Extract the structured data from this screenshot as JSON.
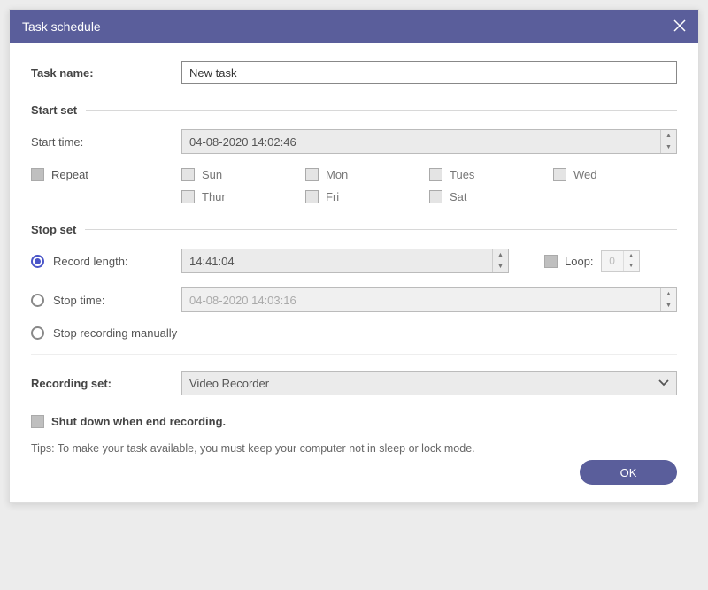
{
  "title": "Task schedule",
  "task_name_label": "Task name:",
  "task_name_value": "New task",
  "start_set": {
    "heading": "Start set",
    "start_time_label": "Start time:",
    "start_time_value": "04-08-2020 14:02:46",
    "repeat_label": "Repeat",
    "days": [
      "Sun",
      "Mon",
      "Tues",
      "Wed",
      "Thur",
      "Fri",
      "Sat"
    ]
  },
  "stop_set": {
    "heading": "Stop set",
    "record_length_label": "Record length:",
    "record_length_value": "14:41:04",
    "loop_label": "Loop:",
    "loop_value": "0",
    "stop_time_label": "Stop time:",
    "stop_time_value": "04-08-2020 14:03:16",
    "stop_manual_label": "Stop recording manually"
  },
  "recording_set": {
    "label": "Recording set:",
    "value": "Video Recorder"
  },
  "shutdown_label": "Shut down when end recording.",
  "tips": "Tips: To make your task available, you must keep your computer not in sleep or lock mode.",
  "ok_label": "OK"
}
